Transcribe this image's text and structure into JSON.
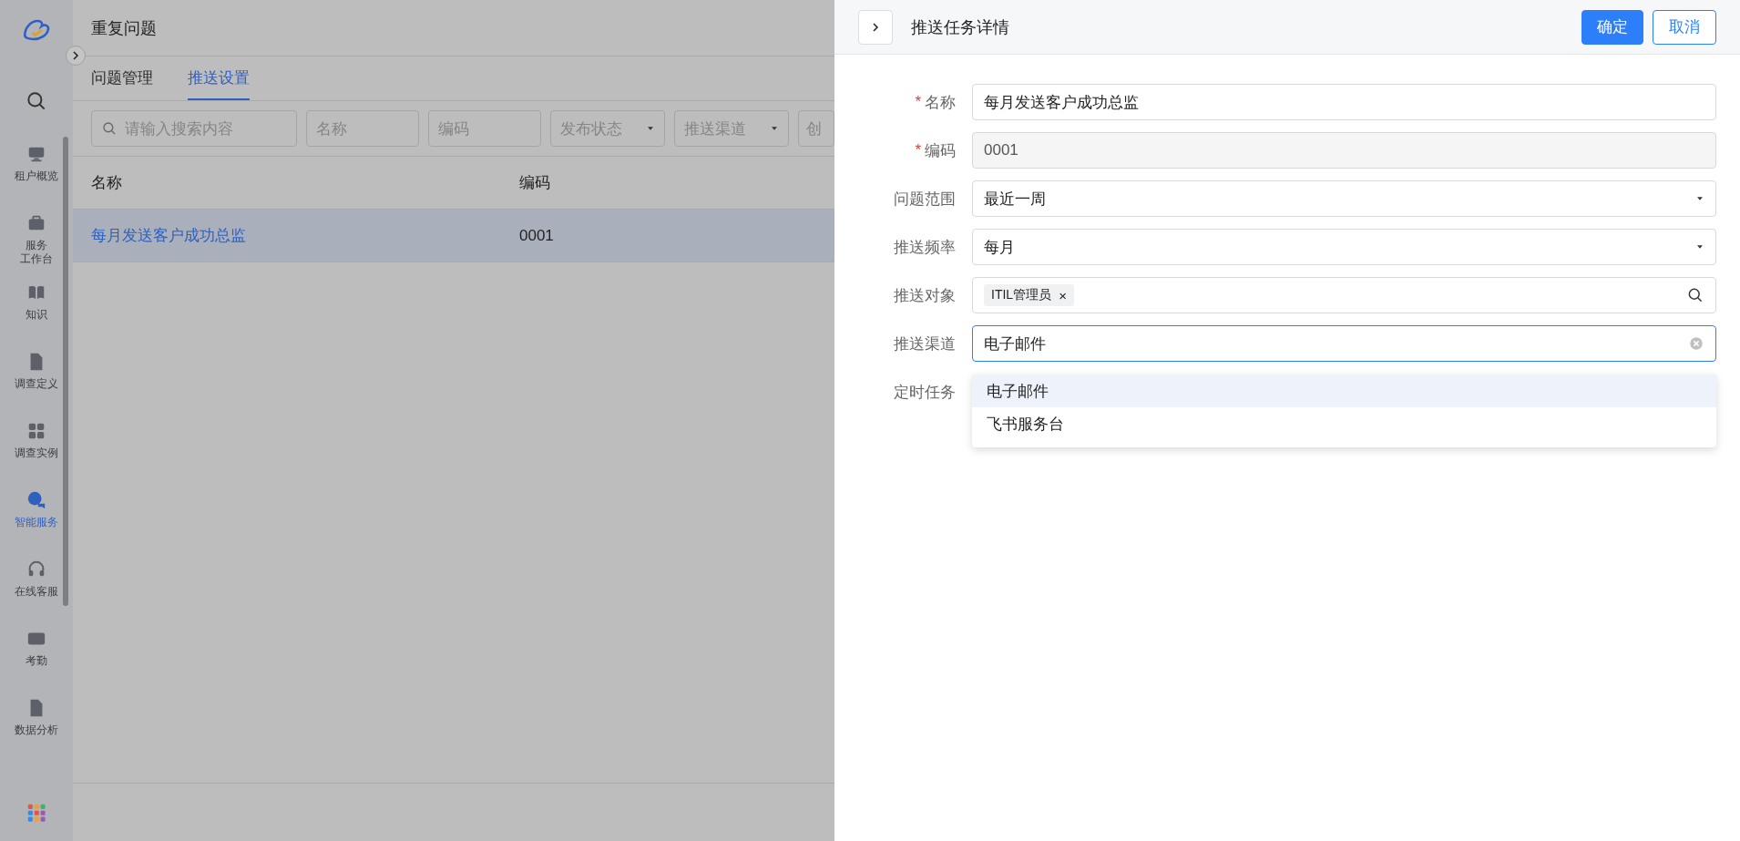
{
  "sidebar": {
    "items": [
      {
        "label": "租户概览",
        "selected": false
      },
      {
        "label": [
          "服务",
          "工作台"
        ],
        "selected": false
      },
      {
        "label": "知识",
        "selected": false
      },
      {
        "label": "调查定义",
        "selected": false
      },
      {
        "label": "调查实例",
        "selected": false
      },
      {
        "label": "智能服务",
        "selected": true
      },
      {
        "label": "在线客服",
        "selected": false
      },
      {
        "label": "考勤",
        "selected": false
      },
      {
        "label": "数据分析",
        "selected": false
      }
    ]
  },
  "page": {
    "title": "重复问题",
    "tabs": [
      {
        "label": "问题管理",
        "selected": false
      },
      {
        "label": "推送设置",
        "selected": true
      }
    ],
    "filters": [
      {
        "kind": "search",
        "placeholder": "请输入搜索内容"
      },
      {
        "kind": "text",
        "placeholder": "名称"
      },
      {
        "kind": "text",
        "placeholder": "编码"
      },
      {
        "kind": "select",
        "placeholder": "发布状态"
      },
      {
        "kind": "select",
        "placeholder": "推送渠道"
      },
      {
        "kind": "text",
        "placeholder": "创"
      }
    ],
    "table": {
      "columns": [
        "名称",
        "编码"
      ],
      "rows": [
        {
          "cells": [
            "每月发送客户成功总监",
            "0001"
          ],
          "selected": true
        }
      ]
    }
  },
  "drawer": {
    "title": "推送任务详情",
    "buttons": [
      {
        "label": "确定",
        "kind": "primary"
      },
      {
        "label": "取消",
        "kind": "default"
      }
    ],
    "fields": [
      {
        "label": "名称",
        "required_mark": "*",
        "kind": "text",
        "value": "每月发送客户成功总监"
      },
      {
        "label": "编码",
        "required_mark": "*",
        "kind": "readonly",
        "value": "0001"
      },
      {
        "label": "问题范围",
        "kind": "select",
        "value": "最近一周"
      },
      {
        "label": "推送频率",
        "kind": "select",
        "value": "每月"
      },
      {
        "label": "推送对象",
        "kind": "tags",
        "tags": [
          {
            "label": "ITIL管理员",
            "remove": "×"
          }
        ]
      },
      {
        "label": "推送渠道",
        "kind": "select",
        "value": "电子邮件",
        "open": true,
        "options": [
          {
            "label": "电子邮件",
            "selected": true
          },
          {
            "label": "飞书服务台",
            "selected": false
          }
        ]
      },
      {
        "label": "定时任务",
        "kind": "empty"
      }
    ]
  }
}
